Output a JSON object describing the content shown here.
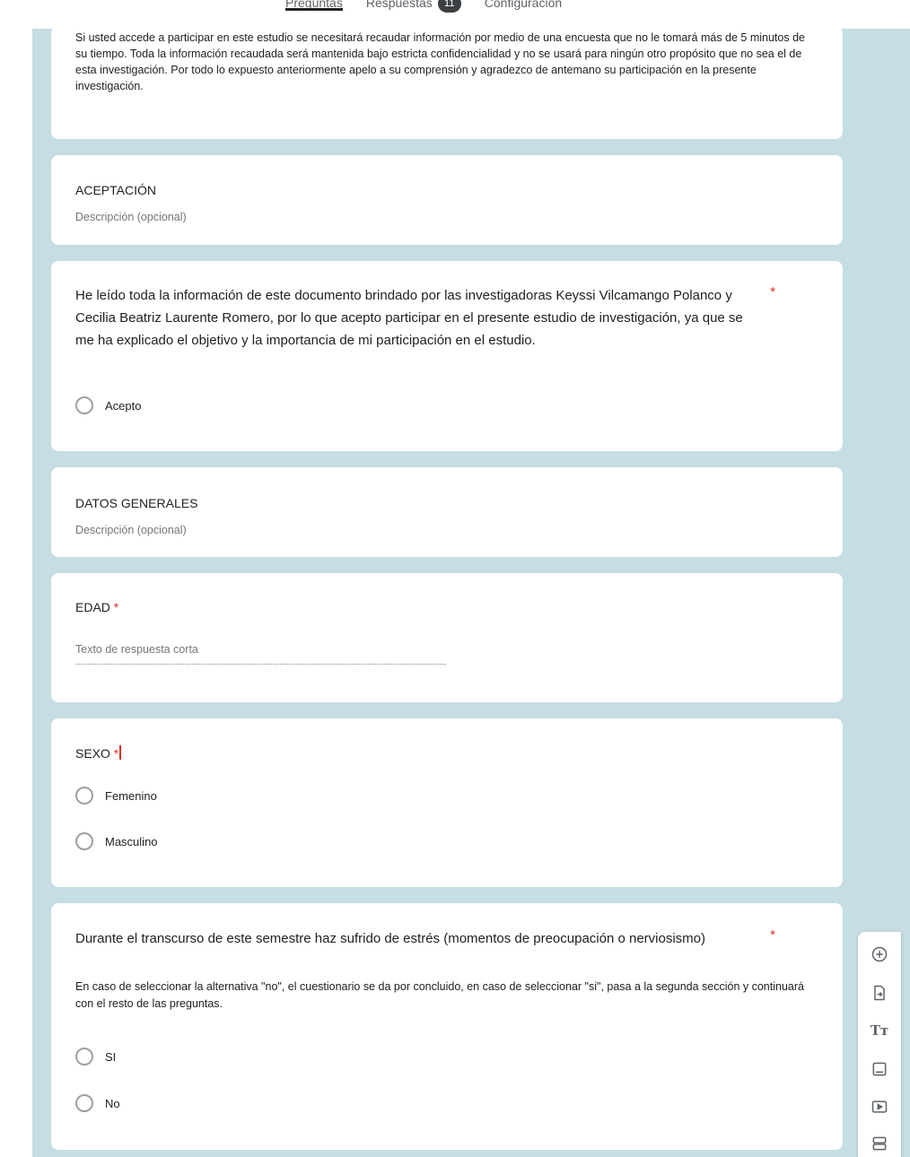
{
  "tabs": [
    {
      "label": "Preguntas"
    },
    {
      "label": "Respuestas",
      "badge": "11"
    },
    {
      "label": "Configuración"
    }
  ],
  "intro": {
    "text": "Si usted accede a participar en este estudio se necesitará recaudar información por medio de una encuesta que no le tomará más de 5 minutos de su tiempo. Toda la información recaudada será mantenida bajo estricta confidencialidad y no se usará para ningún otro propósito que no sea el de esta investigación. Por todo lo expuesto anteriormente apelo a su comprensión y agradezco de antemano su participación en la presente investigación."
  },
  "section_aceptacion": {
    "title": "ACEPTACIÓN",
    "description_placeholder": "Descripción (opcional)"
  },
  "q_consent": {
    "title": "He leído toda la información de este documento brindado por las investigadoras Keyssi Vilcamango Polanco y Cecilia Beatriz Laurente Romero, por lo que acepto participar en el presente estudio de investigación, ya que se me ha explicado el objetivo y la importancia de mi participación en el estudio.",
    "required_mark": "*",
    "options": [
      "Acepto"
    ]
  },
  "section_datos": {
    "title": "DATOS GENERALES",
    "description_placeholder": "Descripción (opcional)"
  },
  "q_edad": {
    "title": "EDAD",
    "required_mark": "*",
    "answer_placeholder": "Texto de respuesta corta"
  },
  "q_sexo": {
    "title": "SEXO",
    "required_mark": "*",
    "options": [
      "Femenino",
      "Masculino"
    ]
  },
  "q_estres": {
    "title": "Durante  el transcurso de este semestre haz sufrido de estrés (momentos de preocupación o nerviosismo)",
    "required_mark": "*",
    "help": "En caso de seleccionar la alternativa \"no\", el cuestionario se da por concluido, en caso de seleccionar \"si\", pasa a la  segunda sección  y continuará con el resto de las preguntas.",
    "options": [
      "SI",
      "No"
    ]
  },
  "toolbar": {
    "icons": [
      "add-question-icon",
      "import-questions-icon",
      "add-title-icon",
      "add-image-icon",
      "add-video-icon",
      "add-section-icon"
    ]
  },
  "colors": {
    "background": "#c5dde3",
    "card": "#ffffff",
    "required": "#d93025"
  }
}
